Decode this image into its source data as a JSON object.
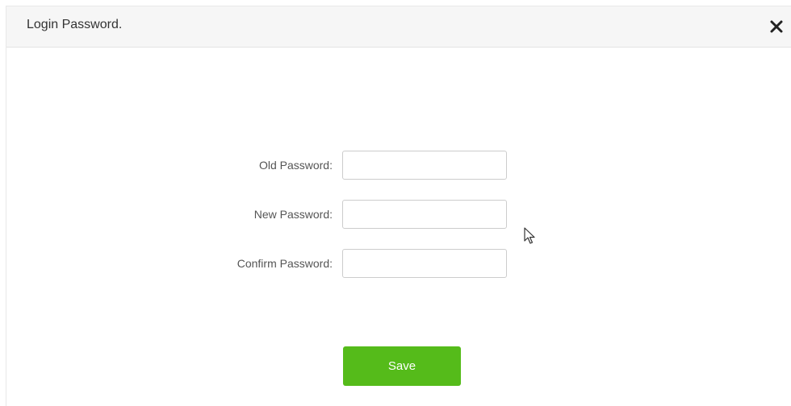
{
  "dialog": {
    "title": "Login Password.",
    "close_icon": "close-icon"
  },
  "form": {
    "fields": [
      {
        "label": "Old Password:",
        "value": "",
        "placeholder": ""
      },
      {
        "label": "New Password:",
        "value": "",
        "placeholder": ""
      },
      {
        "label": "Confirm Password:",
        "value": "",
        "placeholder": ""
      }
    ],
    "save_label": "Save"
  },
  "colors": {
    "save_button": "#55bb1a",
    "header_bg": "#f6f6f6"
  }
}
